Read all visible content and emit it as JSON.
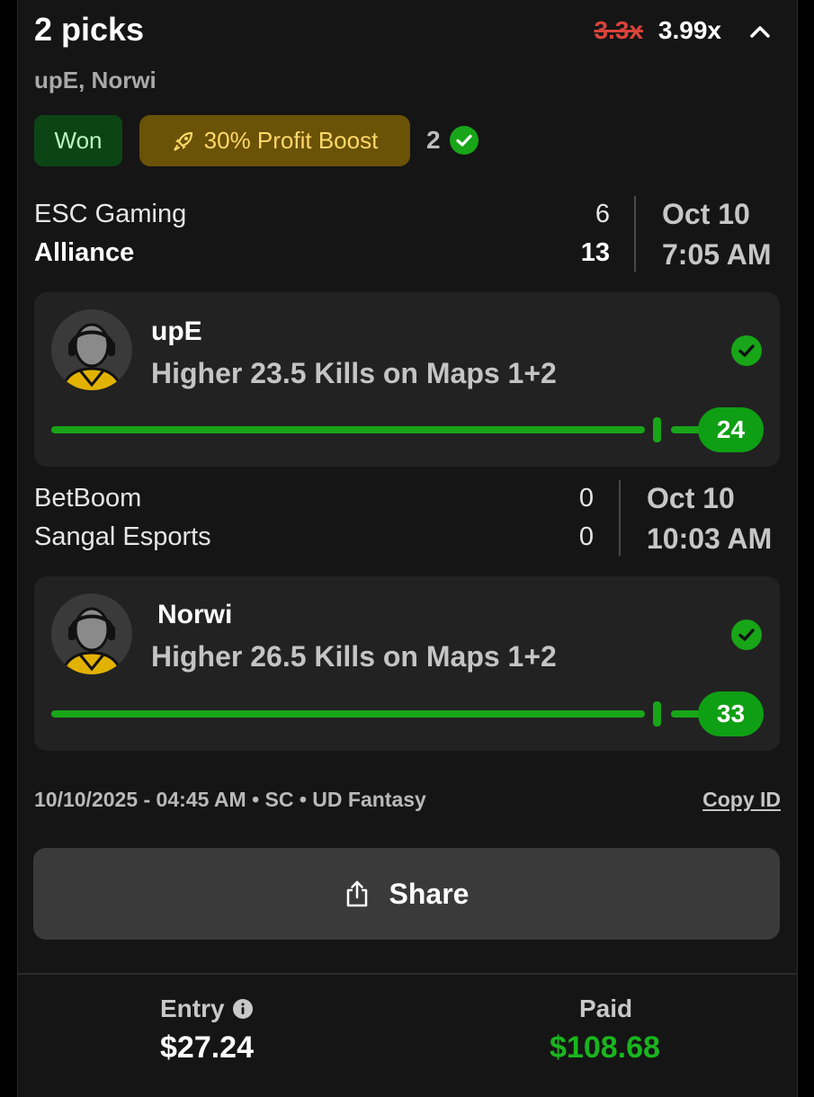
{
  "header": {
    "title": "2 picks",
    "multiplier_old": "3.3x",
    "multiplier_new": "3.99x",
    "subtitle": "upE, Norwi",
    "collapse_icon": "chevron-up-icon"
  },
  "badges": {
    "status": "Won",
    "boost_label": "30% Profit Boost",
    "boost_icon": "rocket-icon",
    "wins_count": "2"
  },
  "games": [
    {
      "team1": "ESC Gaming",
      "score1": "6",
      "team2": "Alliance",
      "score2": "13",
      "date": "Oct 10",
      "time": "7:05 AM"
    },
    {
      "team1": "BetBoom",
      "score1": "0",
      "team2": "Sangal Esports",
      "score2": "0",
      "date": "Oct 10",
      "time": "10:03 AM"
    }
  ],
  "picks": [
    {
      "player": "upE",
      "line": "Higher 23.5  Kills on Maps 1+2",
      "result": "24",
      "target": 23.5
    },
    {
      "player": "Norwi",
      "line": "Higher 26.5  Kills on Maps 1+2",
      "result": "33",
      "target": 26.5
    }
  ],
  "meta": {
    "info": "10/10/2025 - 04:45 AM • SC • UD Fantasy",
    "copy_id": "Copy ID"
  },
  "share": {
    "label": "Share",
    "icon": "share-icon"
  },
  "footer": {
    "entry_label": "Entry",
    "entry_value": "$27.24",
    "paid_label": "Paid",
    "paid_value": "$108.68"
  },
  "colors": {
    "green": "#18a518",
    "paid_green": "#19b51e",
    "strike_red": "#d9433a",
    "won_badge_bg": "#0c4515",
    "boost_badge_bg": "#6a5206"
  }
}
